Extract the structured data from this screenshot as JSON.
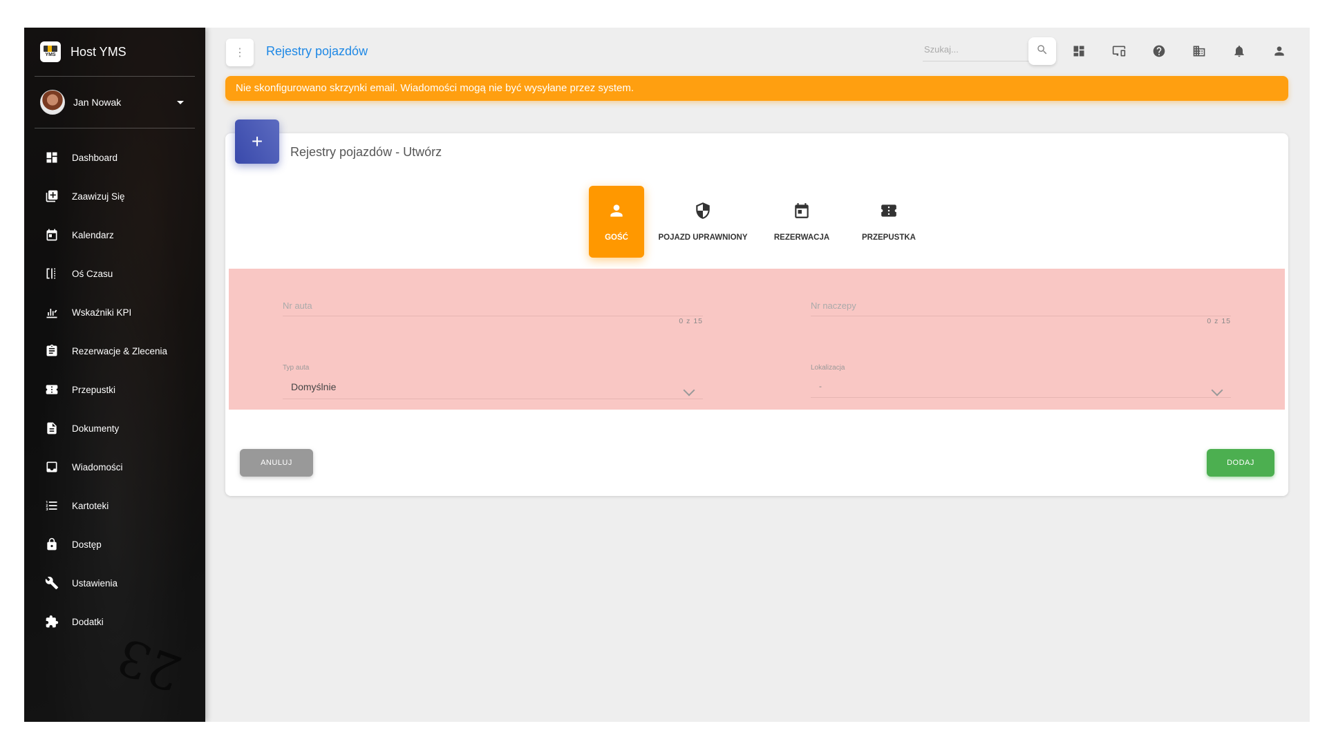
{
  "app": {
    "name": "Host YMS",
    "logo_text": "YMS"
  },
  "user": {
    "name": "Jan Nowak"
  },
  "sidebar": {
    "items": [
      {
        "label": "Dashboard",
        "icon": "dashboard-icon"
      },
      {
        "label": "Zaawizuj Się",
        "icon": "add-box-icon"
      },
      {
        "label": "Kalendarz",
        "icon": "calendar-icon"
      },
      {
        "label": "Oś Czasu",
        "icon": "timeline-icon"
      },
      {
        "label": "Wskaźniki KPI",
        "icon": "kpi-chart-icon"
      },
      {
        "label": "Rezerwacje & Zlecenia",
        "icon": "clipboard-icon"
      },
      {
        "label": "Przepustki",
        "icon": "ticket-icon"
      },
      {
        "label": "Dokumenty",
        "icon": "document-icon"
      },
      {
        "label": "Wiadomości",
        "icon": "inbox-icon"
      },
      {
        "label": "Kartoteki",
        "icon": "list-icon"
      },
      {
        "label": "Dostęp",
        "icon": "lock-icon"
      },
      {
        "label": "Ustawienia",
        "icon": "wrench-icon"
      },
      {
        "label": "Dodatki",
        "icon": "puzzle-icon"
      }
    ],
    "decor_text": "23"
  },
  "topbar": {
    "title": "Rejestry pojazdów",
    "search_placeholder": "Szukaj...",
    "icons": [
      "dashboard-icon",
      "monitor-icon",
      "help-icon",
      "building-icon",
      "notifications-icon",
      "account-icon"
    ]
  },
  "alert": {
    "text": "Nie skonfigurowano skrzynki email. Wiadomości mogą nie być wysyłane przez system."
  },
  "card": {
    "icon_text": "+",
    "title": "Rejestry pojazdów - Utwórz",
    "tabs": [
      {
        "label": "GOŚĆ",
        "icon": "person-icon",
        "active": true
      },
      {
        "label": "POJAZD UPRAWNIONY",
        "icon": "shield-icon",
        "active": false
      },
      {
        "label": "REZERWACJA",
        "icon": "calendar-icon",
        "active": false
      },
      {
        "label": "PRZEPUSTKA",
        "icon": "ticket-icon",
        "active": false
      }
    ],
    "fields": {
      "car_number": {
        "label": "Nr auta",
        "counter": "0 z 15"
      },
      "trailer_number": {
        "label": "Nr naczepy",
        "counter": "0 z 15"
      },
      "car_type": {
        "label": "Typ auta",
        "value": "Domyślnie"
      },
      "location": {
        "label": "Lokalizacja",
        "value": "-"
      }
    },
    "buttons": {
      "cancel": "ANULUJ",
      "add": "DODAJ"
    }
  },
  "colors": {
    "accent": "#1e88e5",
    "alert": "#ff9f10",
    "tab_active": "#ff9800",
    "form_bg": "#f9c7c4",
    "add": "#4caf50",
    "cancel": "#999999",
    "card_icon": "#3949ab"
  }
}
